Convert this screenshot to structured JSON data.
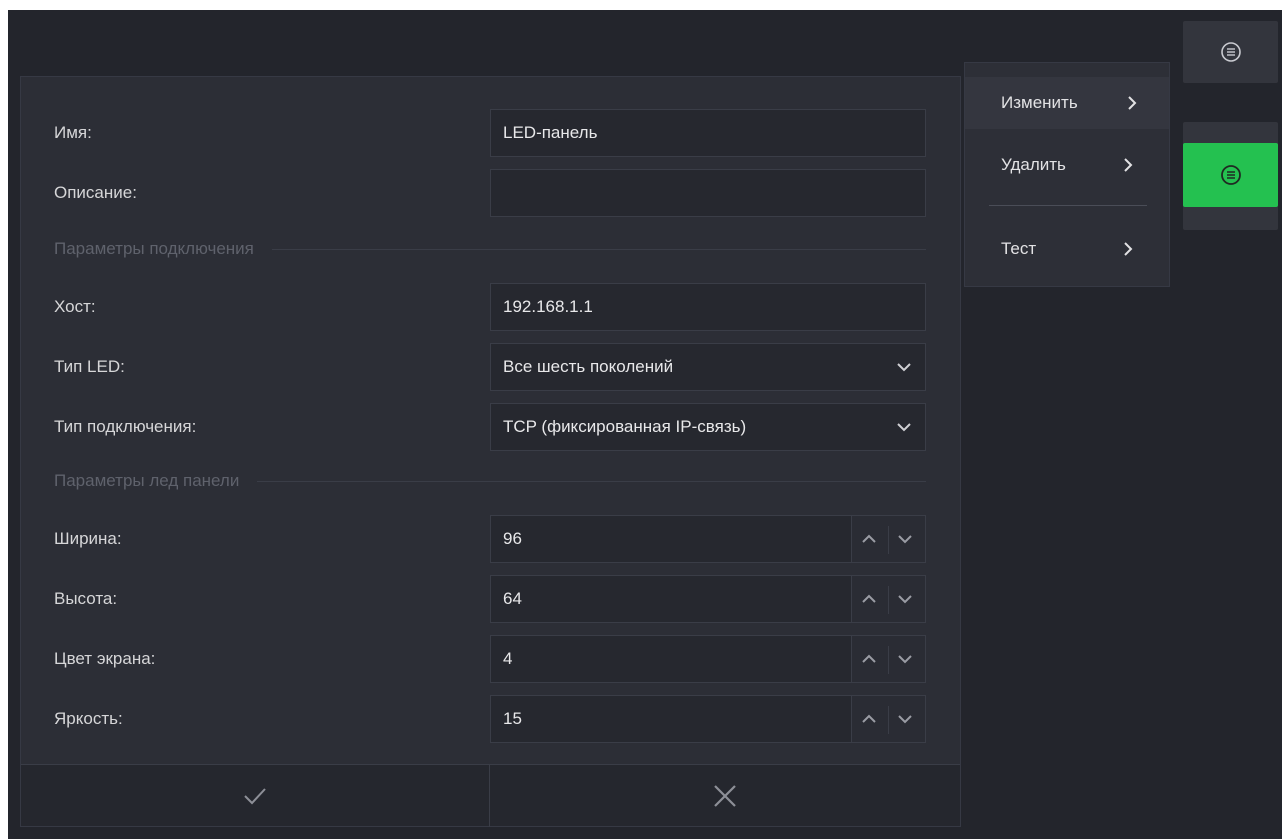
{
  "form": {
    "name_label": "Имя:",
    "name_value": "LED-панель",
    "description_label": "Описание:",
    "description_value": "",
    "connection_section": "Параметры подключения",
    "host_label": "Хост:",
    "host_value": "192.168.1.1",
    "led_type_label": "Тип LED:",
    "led_type_value": "Все шесть поколений",
    "conn_type_label": "Тип подключения:",
    "conn_type_value": "TCP (фиксированная IP-связь)",
    "panel_section": "Параметры лед панели",
    "width_label": "Ширина:",
    "width_value": "96",
    "height_label": "Высота:",
    "height_value": "64",
    "color_label": "Цвет экрана:",
    "color_value": "4",
    "brightness_label": "Яркость:",
    "brightness_value": "15"
  },
  "footer": {
    "confirm_icon": "check-icon",
    "cancel_icon": "close-icon"
  },
  "context_menu": {
    "items": [
      {
        "label": "Изменить"
      },
      {
        "label": "Удалить"
      },
      {
        "label": "Тест"
      }
    ]
  },
  "side_buttons": {
    "icon": "list-icon",
    "active_color": "#24c150"
  },
  "colors": {
    "background": "#23252c",
    "panel": "#2c2e36",
    "accent": "#24c150"
  }
}
